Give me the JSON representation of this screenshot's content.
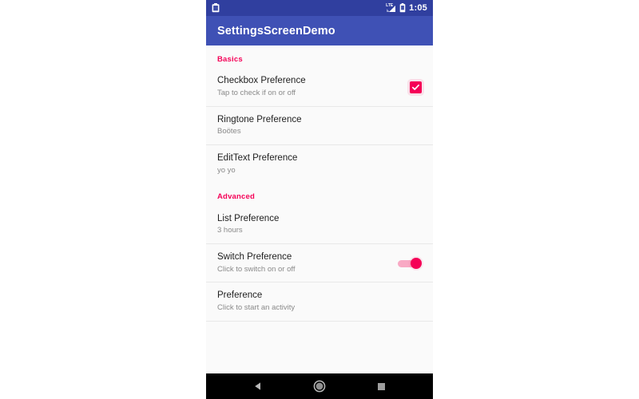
{
  "status_bar": {
    "left_icons": [
      {
        "name": "clipboard-notification-icon",
        "glyph": "clipboard"
      }
    ],
    "network_label": "LTE",
    "right_icons": [
      {
        "name": "signal-cellular-icon",
        "glyph": "signal"
      },
      {
        "name": "battery-icon",
        "glyph": "battery"
      }
    ],
    "time": "1:05",
    "background_color": "#303F9F"
  },
  "app_bar": {
    "title": "SettingsScreenDemo",
    "background_color": "#3F51B5",
    "text_color": "#FFFFFF"
  },
  "theme": {
    "accent_color": "#F50057",
    "switch_track_color": "#F8A9C4",
    "list_background": "#FAFAFA",
    "divider_color": "#E8E8E8",
    "title_color": "#212121",
    "summary_color": "#8A8A8A"
  },
  "sections": [
    {
      "category": "Basics",
      "items": [
        {
          "title": "Checkbox Preference",
          "summary": "Tap to check if on or off",
          "widget": "checkbox",
          "checked": true
        },
        {
          "title": "Ringtone Preference",
          "summary": "Boötes",
          "widget": "none"
        },
        {
          "title": "EditText Preference",
          "summary": "yo yo",
          "widget": "none"
        }
      ]
    },
    {
      "category": "Advanced",
      "items": [
        {
          "title": "List Preference",
          "summary": "3 hours",
          "widget": "none"
        },
        {
          "title": "Switch Preference",
          "summary": "Click to switch on or off",
          "widget": "switch",
          "checked": true
        },
        {
          "title": "Preference",
          "summary": "Click to start an activity",
          "widget": "none"
        }
      ]
    }
  ],
  "nav_bar": {
    "buttons": [
      {
        "name": "back-button",
        "glyph": "triangle-left"
      },
      {
        "name": "home-button",
        "glyph": "circle"
      },
      {
        "name": "recents-button",
        "glyph": "square"
      }
    ],
    "background_color": "#000000"
  }
}
